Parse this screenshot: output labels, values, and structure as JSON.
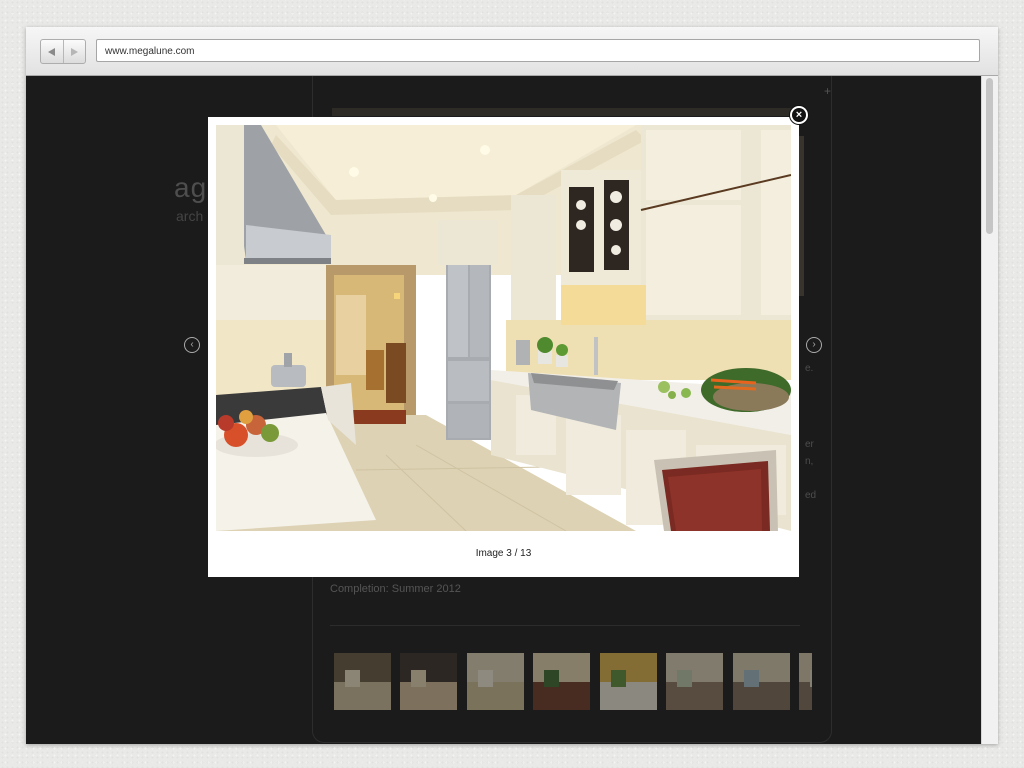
{
  "browser": {
    "url": "www.megalune.com",
    "back_icon": "back-arrow-icon",
    "forward_icon": "forward-arrow-icon"
  },
  "background_page": {
    "logo": "ag",
    "logo_sub": "arch",
    "text_fragments": [
      "e.",
      "er",
      "n,",
      "ed"
    ],
    "completion": "Completion: Summer 2012",
    "thumbnail_count": 8
  },
  "lightbox": {
    "caption": "Image 3 / 13",
    "close_icon": "close-icon",
    "prev_icon": "chevron-left-icon",
    "next_icon": "chevron-right-icon"
  },
  "colors": {
    "overlay": "#1b1b1b",
    "lightbox_bg": "#ffffff",
    "cabinet": "#ece6d4",
    "countertop": "#f5f2ea",
    "floor": "#ddd2b4"
  }
}
